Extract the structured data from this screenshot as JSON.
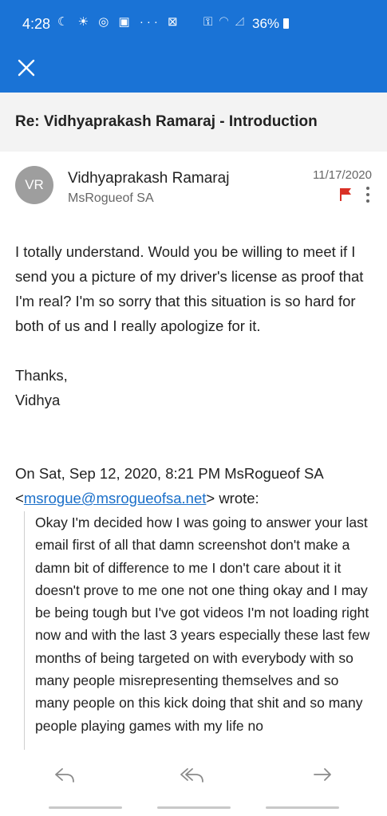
{
  "status_bar": {
    "time": "4:28",
    "left_icons": "☾ ☀ ◎ ▣ ··· ⊠",
    "right_icons": "⚿ ◠ ◿",
    "battery": "36%"
  },
  "header": {
    "close_icon": "close-icon",
    "subject": "Re: Vidhyaprakash Ramaraj - Introduction"
  },
  "message": {
    "avatar_initials": "VR",
    "sender": "Vidhyaprakash Ramaraj",
    "recipient": "MsRogueof SA",
    "date": "11/17/2020",
    "flag_color": "#d93025",
    "paragraph1": "I totally understand. Would you be willing to meet if I send you a picture of my driver's license as proof that I'm real? I'm so sorry that this situation is so hard for both of us and I really apologize for it.",
    "signoff": "Thanks,",
    "signature": "Vidhya",
    "quote_header_prefix": "On Sat, Sep 12, 2020, 8:21 PM MsRogueof SA <",
    "quote_email": "msrogue@msrogueofsa.net",
    "quote_header_suffix": "> wrote:",
    "quoted_text": "Okay I'm decided how I was going to answer your last email first of all that damn screenshot don't make a damn bit of difference to me I don't care about it it doesn't prove to me one not one thing okay and I may be being tough but I've got videos I'm not loading right now and with the last 3 years especially these last few months of being targeted on with everybody with so many people misrepresenting themselves and so many people on this kick doing that shit and so many people playing games with my life no"
  },
  "bottom_bar": {
    "reply_icon": "reply-icon",
    "reply_all_icon": "reply-all-icon",
    "forward_icon": "forward-icon"
  },
  "colors": {
    "accent": "#1a73d6",
    "link": "#1a6fc9"
  }
}
